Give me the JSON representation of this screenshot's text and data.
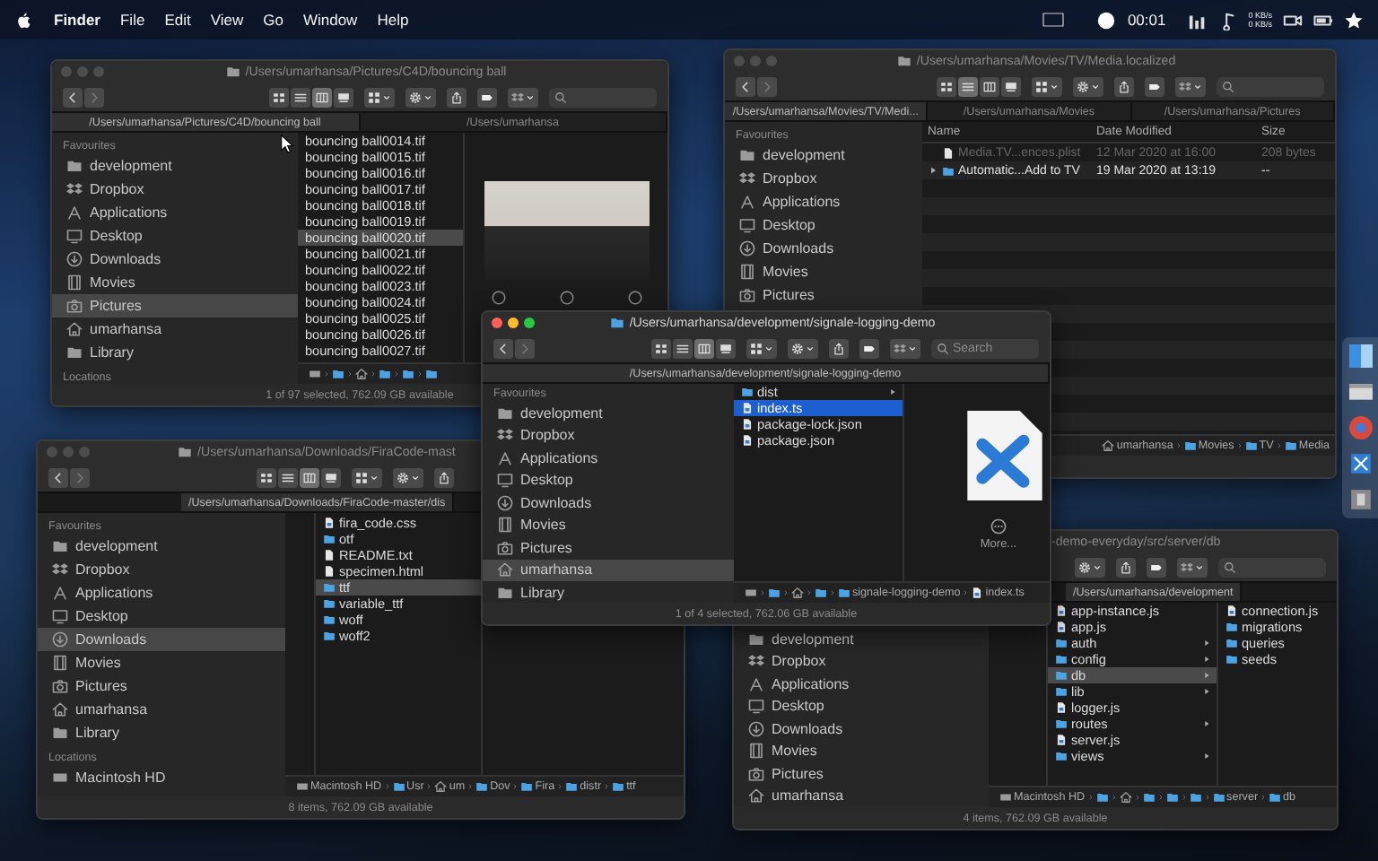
{
  "menubar": {
    "app": "Finder",
    "menus": [
      "File",
      "Edit",
      "View",
      "Go",
      "Window",
      "Help"
    ],
    "clock": "00:01",
    "net_up": "0 KB/s",
    "net_down": "0 KB/s"
  },
  "windows": [
    {
      "title": "/Users/umarhansa/Pictures/C4D/bouncing ball",
      "active": false,
      "views": [
        {
          "selected": false
        },
        {
          "selected": false
        },
        {
          "selected": true
        },
        {
          "selected": false
        }
      ],
      "tabs": [
        {
          "label": "/Users/umarhansa/Pictures/C4D/bouncing ball",
          "selected": true
        },
        {
          "label": "/Users/umarhansa",
          "selected": false
        }
      ],
      "sidebar": [
        {
          "heading": "Favourites",
          "items": [
            {
              "label": "development",
              "kind": "folder",
              "selected": false
            },
            {
              "label": "Dropbox",
              "kind": "box",
              "selected": false
            },
            {
              "label": "Applications",
              "kind": "apps",
              "selected": false
            },
            {
              "label": "Desktop",
              "kind": "desktop",
              "selected": false
            },
            {
              "label": "Downloads",
              "kind": "download",
              "selected": false
            },
            {
              "label": "Movies",
              "kind": "movies",
              "selected": false
            },
            {
              "label": "Pictures",
              "kind": "pictures",
              "selected": true
            },
            {
              "label": "umarhansa",
              "kind": "home",
              "selected": false
            },
            {
              "label": "Library",
              "kind": "folder",
              "selected": false
            }
          ]
        },
        {
          "heading": "Locations"
        }
      ],
      "columns": [
        {
          "entries": [
            {
              "label": "bouncing ball0014.tif",
              "kind": "tif",
              "selected": false
            },
            {
              "label": "bouncing ball0015.tif",
              "kind": "tif",
              "selected": false
            },
            {
              "label": "bouncing ball0016.tif",
              "kind": "tif",
              "selected": false
            },
            {
              "label": "bouncing ball0017.tif",
              "kind": "tif",
              "selected": false
            },
            {
              "label": "bouncing ball0018.tif",
              "kind": "tif",
              "selected": false
            },
            {
              "label": "bouncing ball0019.tif",
              "kind": "tif",
              "selected": false
            },
            {
              "label": "bouncing ball0020.tif",
              "kind": "tif",
              "selected": true
            },
            {
              "label": "bouncing ball0021.tif",
              "kind": "tif",
              "selected": false
            },
            {
              "label": "bouncing ball0022.tif",
              "kind": "tif",
              "selected": false
            },
            {
              "label": "bouncing ball0023.tif",
              "kind": "tif",
              "selected": false
            },
            {
              "label": "bouncing ball0024.tif",
              "kind": "tif",
              "selected": false
            },
            {
              "label": "bouncing ball0025.tif",
              "kind": "tif",
              "selected": false
            },
            {
              "label": "bouncing ball0026.tif",
              "kind": "tif",
              "selected": false
            },
            {
              "label": "bouncing ball0027.tif",
              "kind": "tif",
              "selected": false
            }
          ]
        }
      ],
      "preview": {
        "kind": "image"
      },
      "breadcrumbs": [
        {
          "kind": "disk"
        },
        {
          "kind": "folder"
        },
        {
          "kind": "home"
        },
        {
          "kind": "folder"
        },
        {
          "kind": "folder"
        },
        {
          "kind": "folder"
        }
      ],
      "status": "1 of 97 selected, 762.09 GB available"
    },
    {
      "title": "/Users/umarhansa/Movies/TV/Media.localized",
      "active": false,
      "views": [
        {
          "selected": false
        },
        {
          "selected": true
        },
        {
          "selected": false
        },
        {
          "selected": false
        }
      ],
      "tabs": [
        {
          "label": "/Users/umarhansa/Movies/TV/Medi...",
          "selected": true
        },
        {
          "label": "/Users/umarhansa/Movies",
          "selected": false
        },
        {
          "label": "/Users/umarhansa/Pictures",
          "selected": false
        }
      ],
      "sidebar": [
        {
          "heading": "Favourites",
          "items": [
            {
              "label": "development",
              "kind": "folder",
              "selected": false
            },
            {
              "label": "Dropbox",
              "kind": "box",
              "selected": false
            },
            {
              "label": "Applications",
              "kind": "apps",
              "selected": false
            },
            {
              "label": "Desktop",
              "kind": "desktop",
              "selected": false
            },
            {
              "label": "Downloads",
              "kind": "download",
              "selected": false
            },
            {
              "label": "Movies",
              "kind": "movies",
              "selected": false
            },
            {
              "label": "Pictures",
              "kind": "pictures",
              "selected": false
            }
          ]
        }
      ],
      "list": {
        "columns": [
          "Name",
          "Date Modified",
          "Size"
        ],
        "rows": [
          {
            "kind": "file",
            "dimmed": true,
            "cells": [
              "Media.TV...ences.plist",
              "12 Mar 2020 at 16:00",
              "208 bytes"
            ]
          },
          {
            "kind": "folder",
            "dimmed": false,
            "expanded": false,
            "cells": [
              "Automatic...Add to TV",
              "19 Mar 2020 at 13:19",
              "--"
            ]
          }
        ]
      },
      "breadcrumbs": [
        {
          "kind": "home",
          "label": "umarhansa"
        },
        {
          "kind": "folder",
          "label": "Movies"
        },
        {
          "kind": "folder",
          "label": "TV"
        },
        {
          "kind": "folder",
          "label": "Media"
        }
      ]
    },
    {
      "title": "/Users/umarhansa/Downloads/FiraCode-mast",
      "active": false,
      "views": [
        {
          "selected": false
        },
        {
          "selected": false
        },
        {
          "selected": true
        },
        {
          "selected": false
        }
      ],
      "tabs": [
        {
          "label": "/Users/umarhansa/Downloads/FiraCode-master/dis",
          "selected": true
        }
      ],
      "sidebar": [
        {
          "heading": "Favourites",
          "items": [
            {
              "label": "development",
              "kind": "folder",
              "selected": false
            },
            {
              "label": "Dropbox",
              "kind": "box",
              "selected": false
            },
            {
              "label": "Applications",
              "kind": "apps",
              "selected": false
            },
            {
              "label": "Desktop",
              "kind": "desktop",
              "selected": false
            },
            {
              "label": "Downloads",
              "kind": "download",
              "selected": true
            },
            {
              "label": "Movies",
              "kind": "movies",
              "selected": false
            },
            {
              "label": "Pictures",
              "kind": "pictures",
              "selected": false
            },
            {
              "label": "umarhansa",
              "kind": "home",
              "selected": false
            },
            {
              "label": "Library",
              "kind": "folder",
              "selected": false
            }
          ]
        },
        {
          "heading": "Locations",
          "items": [
            {
              "label": "Macintosh HD",
              "kind": "disk",
              "selected": false
            }
          ]
        }
      ],
      "columns": [
        {
          "entries": [
            {
              "label": "fira_code.css",
              "kind": "code",
              "selected": false
            },
            {
              "label": "otf",
              "kind": "folder",
              "selected": false
            },
            {
              "label": "README.txt",
              "kind": "file",
              "selected": false
            },
            {
              "label": "specimen.html",
              "kind": "file",
              "selected": false
            },
            {
              "label": "ttf",
              "kind": "folder",
              "selected": true
            },
            {
              "label": "variable_ttf",
              "kind": "folder",
              "selected": false
            },
            {
              "label": "woff",
              "kind": "folder",
              "selected": false
            },
            {
              "label": "woff2",
              "kind": "folder",
              "selected": false
            }
          ]
        }
      ],
      "breadcrumbs": [
        {
          "kind": "disk",
          "label": "Macintosh HD"
        },
        {
          "kind": "folder",
          "label": "Usr"
        },
        {
          "kind": "home",
          "label": "um"
        },
        {
          "kind": "folder",
          "label": "Dov"
        },
        {
          "kind": "folder",
          "label": "Fira"
        },
        {
          "kind": "folder",
          "label": "distr"
        },
        {
          "kind": "folder",
          "label": "ttf"
        }
      ],
      "status": "8 items, 762.09 GB available"
    },
    {
      "title": "-demo-everyday/src/server/db",
      "active": false,
      "tabs": [
        {
          "label": "/Users/umarhansa/development",
          "selected": true
        }
      ],
      "sidebar": [
        {
          "items": [
            {
              "label": "development",
              "kind": "folder",
              "selected": false
            },
            {
              "label": "Dropbox",
              "kind": "box",
              "selected": false
            },
            {
              "label": "Applications",
              "kind": "apps",
              "selected": false
            },
            {
              "label": "Desktop",
              "kind": "desktop",
              "selected": false
            },
            {
              "label": "Downloads",
              "kind": "download",
              "selected": false
            },
            {
              "label": "Movies",
              "kind": "movies",
              "selected": false
            },
            {
              "label": "Pictures",
              "kind": "pictures",
              "selected": false
            },
            {
              "label": "umarhansa",
              "kind": "home",
              "selected": false
            }
          ]
        }
      ],
      "columns": [
        {
          "entries": [
            {
              "label": "app-instance.js",
              "kind": "code",
              "selected": false
            },
            {
              "label": "app.js",
              "kind": "code",
              "selected": false
            },
            {
              "label": "auth",
              "kind": "folder",
              "selected": false
            },
            {
              "label": "config",
              "kind": "folder",
              "selected": false
            },
            {
              "label": "db",
              "kind": "folder",
              "selected": true
            },
            {
              "label": "lib",
              "kind": "folder",
              "selected": false
            },
            {
              "label": "logger.js",
              "kind": "code",
              "selected": false
            },
            {
              "label": "routes",
              "kind": "folder",
              "selected": false
            },
            {
              "label": "server.js",
              "kind": "code",
              "selected": false
            },
            {
              "label": "views",
              "kind": "folder",
              "selected": false
            }
          ]
        },
        {
          "entries": [
            {
              "label": "connection.js",
              "kind": "code",
              "selected": false
            },
            {
              "label": "migrations",
              "kind": "folder",
              "selected": false
            },
            {
              "label": "queries",
              "kind": "folder",
              "selected": false
            },
            {
              "label": "seeds",
              "kind": "folder",
              "selected": false
            }
          ]
        }
      ],
      "breadcrumbs": [
        {
          "kind": "disk",
          "label": "Macintosh HD"
        },
        {
          "kind": "folder"
        },
        {
          "kind": "home"
        },
        {
          "kind": "folder"
        },
        {
          "kind": "folder"
        },
        {
          "kind": "folder"
        },
        {
          "kind": "folder",
          "label": "server"
        },
        {
          "kind": "folder",
          "label": "db"
        }
      ],
      "status": "4 items, 762.09 GB available"
    },
    {
      "title": "/Users/umarhansa/development/signale-logging-demo",
      "active": true,
      "views": [
        {
          "selected": false
        },
        {
          "selected": false
        },
        {
          "selected": true
        },
        {
          "selected": false
        }
      ],
      "tabs": [
        {
          "label": "/Users/umarhansa/development/signale-logging-demo",
          "selected": true
        }
      ],
      "search": {
        "placeholder": "Search"
      },
      "sidebar": [
        {
          "heading": "Favourites",
          "items": [
            {
              "label": "development",
              "kind": "folder",
              "selected": false
            },
            {
              "label": "Dropbox",
              "kind": "box",
              "selected": false
            },
            {
              "label": "Applications",
              "kind": "apps",
              "selected": false
            },
            {
              "label": "Desktop",
              "kind": "desktop",
              "selected": false
            },
            {
              "label": "Downloads",
              "kind": "download",
              "selected": false
            },
            {
              "label": "Movies",
              "kind": "movies",
              "selected": false
            },
            {
              "label": "Pictures",
              "kind": "pictures",
              "selected": false
            },
            {
              "label": "umarhansa",
              "kind": "home",
              "selected": true
            },
            {
              "label": "Library",
              "kind": "folder",
              "selected": false
            }
          ]
        }
      ],
      "columns": [
        {
          "entries": [
            {
              "label": "dist",
              "kind": "folder",
              "selected": false
            },
            {
              "label": "index.ts",
              "kind": "code",
              "selected": true
            },
            {
              "label": "package-lock.json",
              "kind": "code",
              "selected": false
            },
            {
              "label": "package.json",
              "kind": "code",
              "selected": false
            }
          ]
        }
      ],
      "preview": {
        "kind": "document",
        "caption": "More..."
      },
      "breadcrumbs": [
        {
          "kind": "disk"
        },
        {
          "kind": "folder"
        },
        {
          "kind": "home"
        },
        {
          "kind": "folder"
        },
        {
          "kind": "folder",
          "label": "signale-logging-demo"
        },
        {
          "kind": "code",
          "label": "index.ts"
        }
      ],
      "status": "1 of 4 selected, 762.06 GB available"
    }
  ]
}
